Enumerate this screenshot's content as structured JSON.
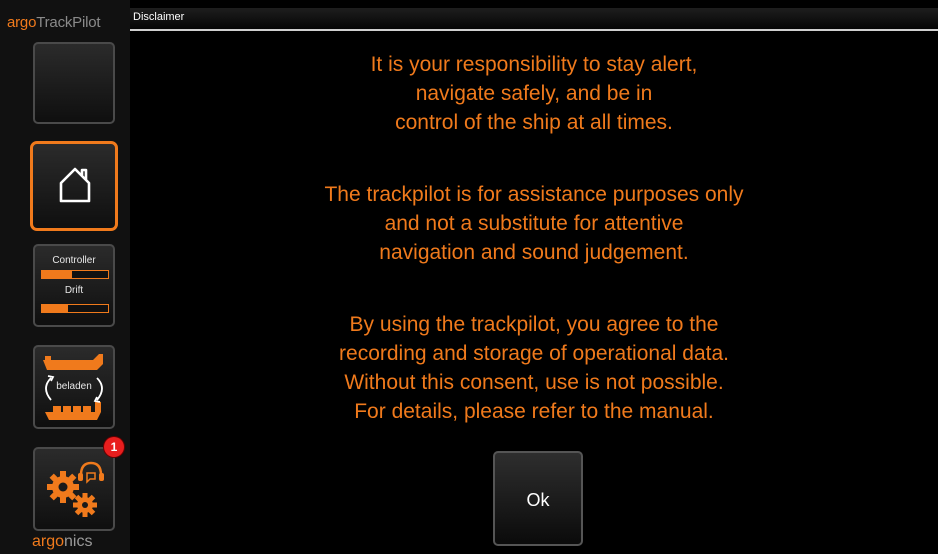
{
  "sidebar": {
    "brand_prefix": "argo",
    "brand_suffix": "TrackPilot",
    "controller_label": "Controller",
    "controller_level": 0.45,
    "drift_label": "Drift",
    "drift_level": 0.4,
    "load_label": "beladen",
    "badge_count": "1",
    "footer_prefix": "argo",
    "footer_suffix": "nics"
  },
  "dialog": {
    "title": "Disclaimer",
    "paragraphs": [
      [
        "It is your responsibility to stay alert,",
        "navigate safely, and be in",
        "control of the ship at all times."
      ],
      [
        "The trackpilot is for assistance purposes only",
        "and not a substitute for attentive",
        "navigation and sound judgement."
      ],
      [
        "By using the trackpilot, you agree to the",
        "recording and storage of operational data.",
        "Without this consent, use is not possible.",
        "For details, please refer to the manual."
      ]
    ],
    "ok_label": "Ok"
  },
  "colors": {
    "accent": "#f07a1c",
    "badge": "#e81e1e",
    "background": "#000000"
  },
  "icons": {
    "home": "home-icon",
    "load": "ship-load-icon",
    "settings": "gears-headset-icon"
  }
}
